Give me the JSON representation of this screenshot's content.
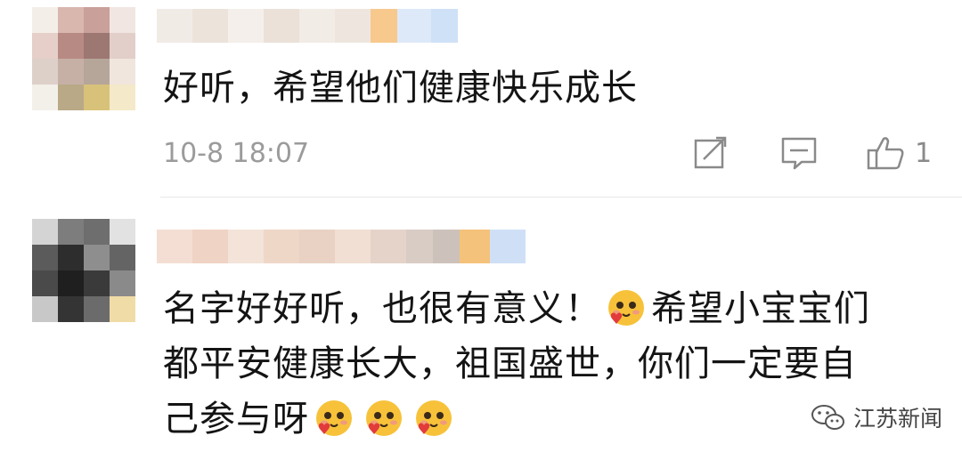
{
  "comments": [
    {
      "text": "好听，希望他们健康快乐成长",
      "timestamp": "10-8 18:07",
      "likes": "1",
      "actions": [
        "repost-icon",
        "comment-icon",
        "like-icon"
      ]
    },
    {
      "line1": "名字好好听，也很有意义！",
      "line1b": "希望小宝宝们",
      "line2": "都平安健康长大，祖国盛世，你们一定要自",
      "line3": "己参与呀",
      "emoji": "blush-heart-emoji"
    }
  ],
  "watermark": {
    "text": "江苏新闻",
    "icon": "wechat-icon"
  },
  "colors": {
    "text": "#141414",
    "meta": "#9b9b9b",
    "divider": "#e8e8e8"
  }
}
